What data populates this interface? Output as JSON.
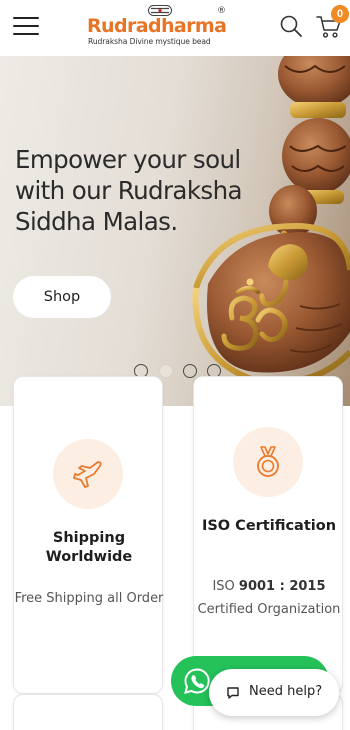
{
  "header": {
    "logo": {
      "name": "Rudradharma",
      "registered": "®",
      "tagline": "Rudraksha Divine mystique bead"
    },
    "menu_icon": "hamburger-menu-icon",
    "search_icon": "search-icon",
    "cart": {
      "icon": "cart-icon",
      "count": "0"
    }
  },
  "hero": {
    "title": "Empower your soul with our Rudraksha Siddha Malas.",
    "button_label": "Shop",
    "slides": 4,
    "active_slide": 2
  },
  "features": [
    {
      "icon": "airplane-icon",
      "title": "Shipping Worldwide",
      "text": "Free Shipping all Order"
    },
    {
      "icon": "medal-icon",
      "title": "ISO Certification",
      "text_prefix": "ISO ",
      "text_bold": "9001 : 2015",
      "text_suffix": " Certified Organization"
    }
  ],
  "chat": {
    "whatsapp_icon": "whatsapp-icon",
    "help_label": "Need help?"
  },
  "colors": {
    "brand": "#e87527",
    "badge": "#f08a24",
    "icon_bg": "#fdeee3",
    "whatsapp": "#25c25a"
  }
}
